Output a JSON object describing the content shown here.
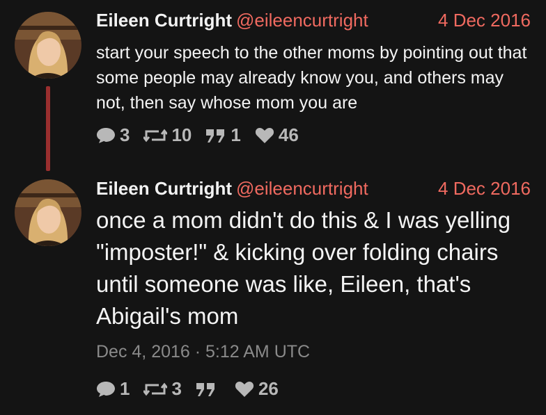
{
  "tweets": [
    {
      "author_name": "Eileen Curtright",
      "handle": "@eileencurtright",
      "date": "4 Dec 2016",
      "text": "start your speech to the other moms by pointing out that some people may already know you, and others may not, then say whose mom you are",
      "stats": {
        "replies": "3",
        "retweets": "10",
        "quotes": "1",
        "likes": "46"
      }
    },
    {
      "author_name": "Eileen Curtright",
      "handle": "@eileencurtright",
      "date": "4 Dec 2016",
      "text": "once a mom didn't do this & I was yelling \"imposter!\" & kicking over folding chairs until someone was like, Eileen, that's Abigail's mom",
      "timestamp": "Dec 4, 2016 · 5:12 AM UTC",
      "stats": {
        "replies": "1",
        "retweets": "3",
        "quotes": "",
        "likes": "26"
      }
    }
  ],
  "colors": {
    "background": "#141414",
    "accent": "#f06a60",
    "thread_line": "#9a2f2f",
    "stat_text": "#b8b8b8"
  },
  "icons": [
    "comment-icon",
    "retweet-icon",
    "quote-icon",
    "heart-icon"
  ]
}
